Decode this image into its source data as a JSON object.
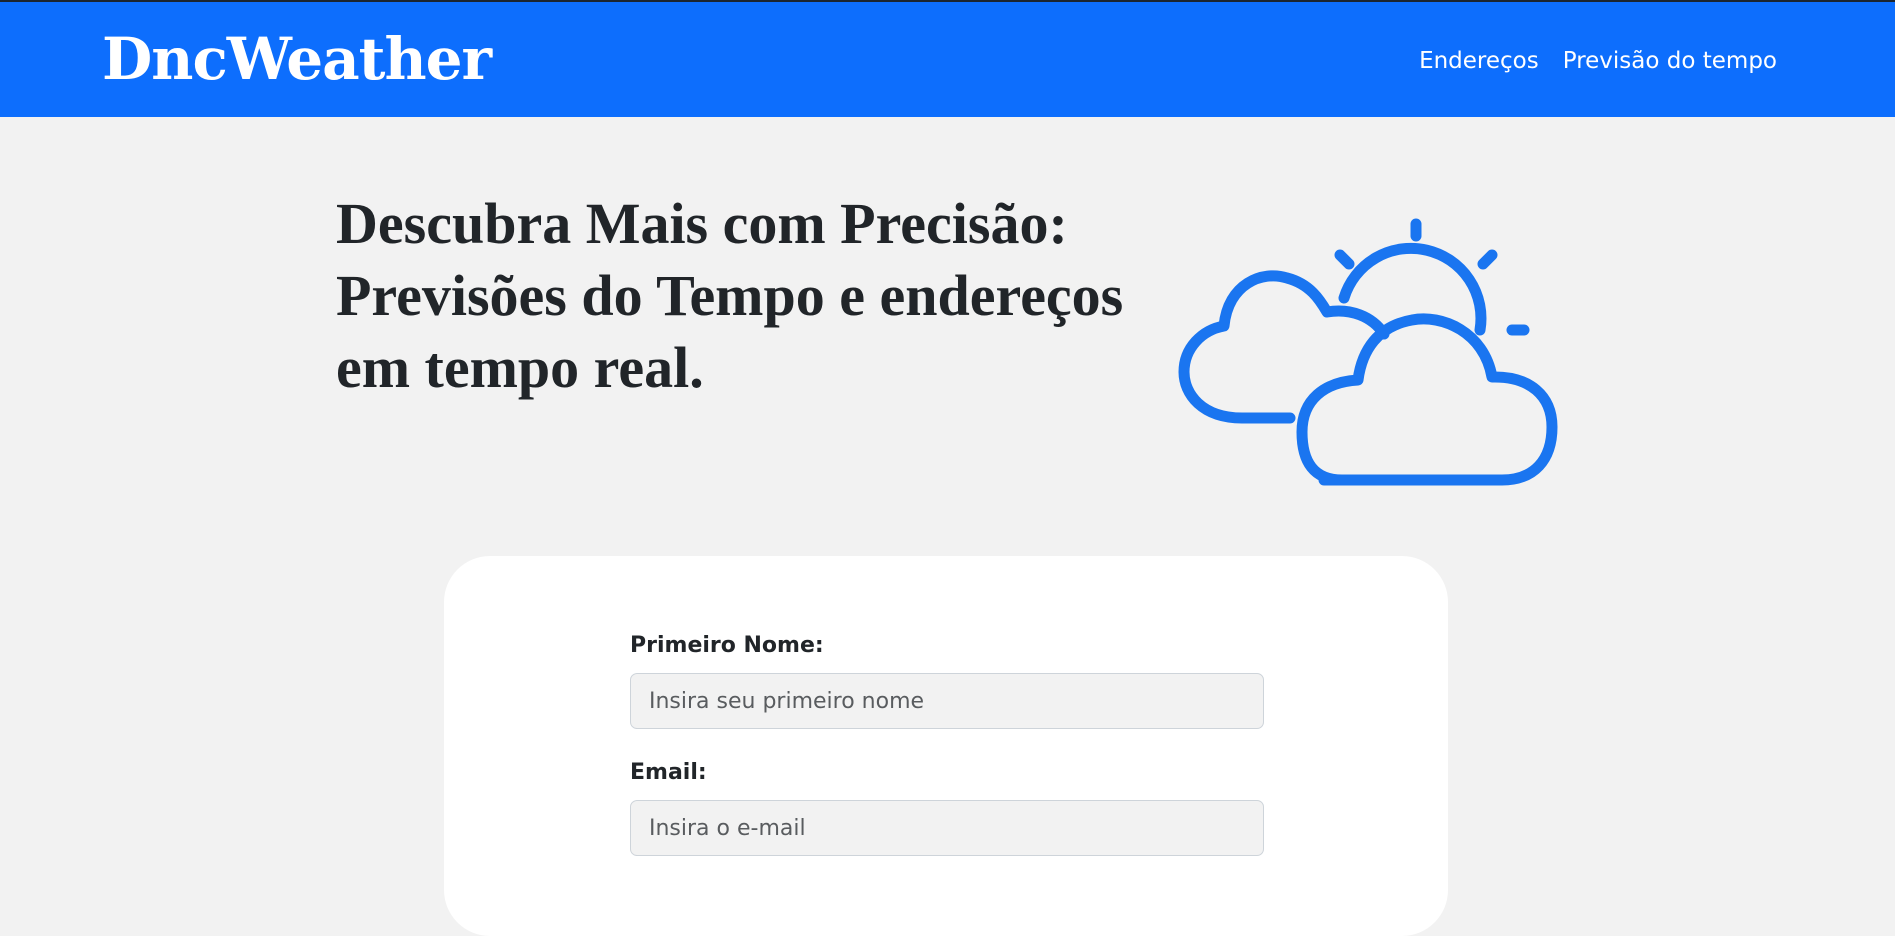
{
  "header": {
    "brand": "DncWeather",
    "nav": [
      {
        "label": "Endereços"
      },
      {
        "label": "Previsão do tempo"
      }
    ]
  },
  "hero": {
    "title_lines": [
      "Descubra Mais com Precisão:",
      "Previsões do Tempo e endereços",
      "em tempo real."
    ],
    "icon": "partly-cloudy-icon",
    "icon_color": "#1a75f0"
  },
  "form": {
    "first_name": {
      "label": "Primeiro Nome:",
      "placeholder": "Insira seu primeiro nome",
      "value": ""
    },
    "email": {
      "label": "Email:",
      "placeholder": "Insira o e-mail",
      "value": ""
    }
  },
  "colors": {
    "topbar": "#0d6efd",
    "background": "#f2f2f2",
    "text": "#212529"
  }
}
